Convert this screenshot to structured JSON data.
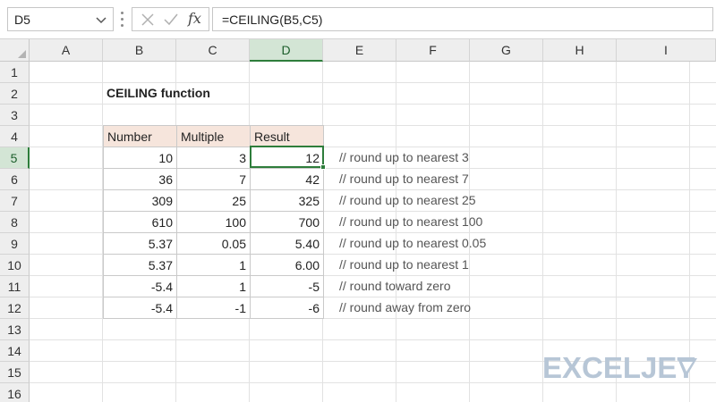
{
  "name_box": {
    "value": "D5"
  },
  "formula_bar": {
    "fx_label": "fx",
    "formula": "=CEILING(B5,C5)"
  },
  "columns": [
    "A",
    "B",
    "C",
    "D",
    "E",
    "F",
    "G",
    "H",
    "I"
  ],
  "active_column": "D",
  "rows": [
    "1",
    "2",
    "3",
    "4",
    "5",
    "6",
    "7",
    "8",
    "9",
    "10",
    "11",
    "12",
    "13",
    "14",
    "15",
    "16"
  ],
  "active_row": "5",
  "sheet": {
    "title": "CEILING function",
    "table": {
      "headers": [
        "Number",
        "Multiple",
        "Result"
      ],
      "rows": [
        [
          "10",
          "3",
          "12"
        ],
        [
          "36",
          "7",
          "42"
        ],
        [
          "309",
          "25",
          "325"
        ],
        [
          "610",
          "100",
          "700"
        ],
        [
          "5.37",
          "0.05",
          "5.40"
        ],
        [
          "5.37",
          "1",
          "6.00"
        ],
        [
          "-5.4",
          "1",
          "-5"
        ],
        [
          "-5.4",
          "-1",
          "-6"
        ]
      ]
    },
    "comments": [
      "// round up to nearest 3",
      "// round up to nearest 7",
      "// round up to nearest 25",
      "// round up to nearest 100",
      "// round up to nearest 0.05",
      "// round up to nearest 1",
      "// round toward zero",
      "// round away from zero"
    ]
  },
  "logo": {
    "text": "EXCELJET"
  },
  "colors": {
    "accent": "#2e7d3b",
    "header_fill": "#f6e5dc",
    "logo": "#b7c6d6"
  }
}
